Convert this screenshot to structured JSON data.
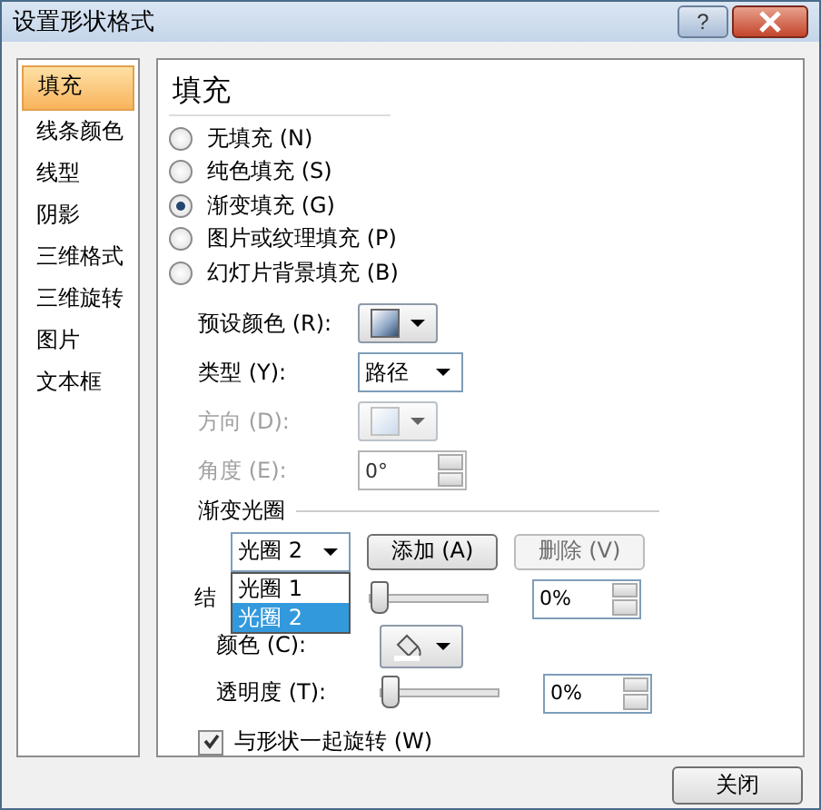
{
  "window": {
    "title": "设置形状格式",
    "help_button": "?"
  },
  "sidebar": {
    "items": [
      {
        "label": "填充",
        "selected": true
      },
      {
        "label": "线条颜色",
        "selected": false
      },
      {
        "label": "线型",
        "selected": false
      },
      {
        "label": "阴影",
        "selected": false
      },
      {
        "label": "三维格式",
        "selected": false
      },
      {
        "label": "三维旋转",
        "selected": false
      },
      {
        "label": "图片",
        "selected": false
      },
      {
        "label": "文本框",
        "selected": false
      }
    ]
  },
  "fill": {
    "heading": "填充",
    "options": [
      {
        "label": "无填充 (N)",
        "selected": false
      },
      {
        "label": "纯色填充 (S)",
        "selected": false
      },
      {
        "label": "渐变填充 (G)",
        "selected": true
      },
      {
        "label": "图片或纹理填充 (P)",
        "selected": false
      },
      {
        "label": "幻灯片背景填充 (B)",
        "selected": false
      }
    ]
  },
  "preset_colors": {
    "label": "预设颜色 (R):"
  },
  "type": {
    "label": "类型 (Y):",
    "value": "路径"
  },
  "direction": {
    "label": "方向 (D):",
    "disabled": true
  },
  "angle": {
    "label": "角度 (E):",
    "value": "0°",
    "disabled": true
  },
  "stops": {
    "title": "渐变光圈",
    "stop_select": "光圈 2",
    "add": "添加 (A)",
    "delete": {
      "label": "删除 (V)",
      "disabled": true
    },
    "list": [
      {
        "label": "光圈 1",
        "selected": false
      },
      {
        "label": "光圈 2",
        "selected": true
      }
    ],
    "position": {
      "label": "结",
      "level": 0,
      "value": "0%"
    },
    "color": {
      "label": "颜色 (C):"
    },
    "transparency": {
      "label": "透明度 (T):",
      "level": 0,
      "value": "0%"
    }
  },
  "rotate": {
    "label": "与形状一起旋转 (W)",
    "checked": true
  },
  "close_button": "关闭"
}
